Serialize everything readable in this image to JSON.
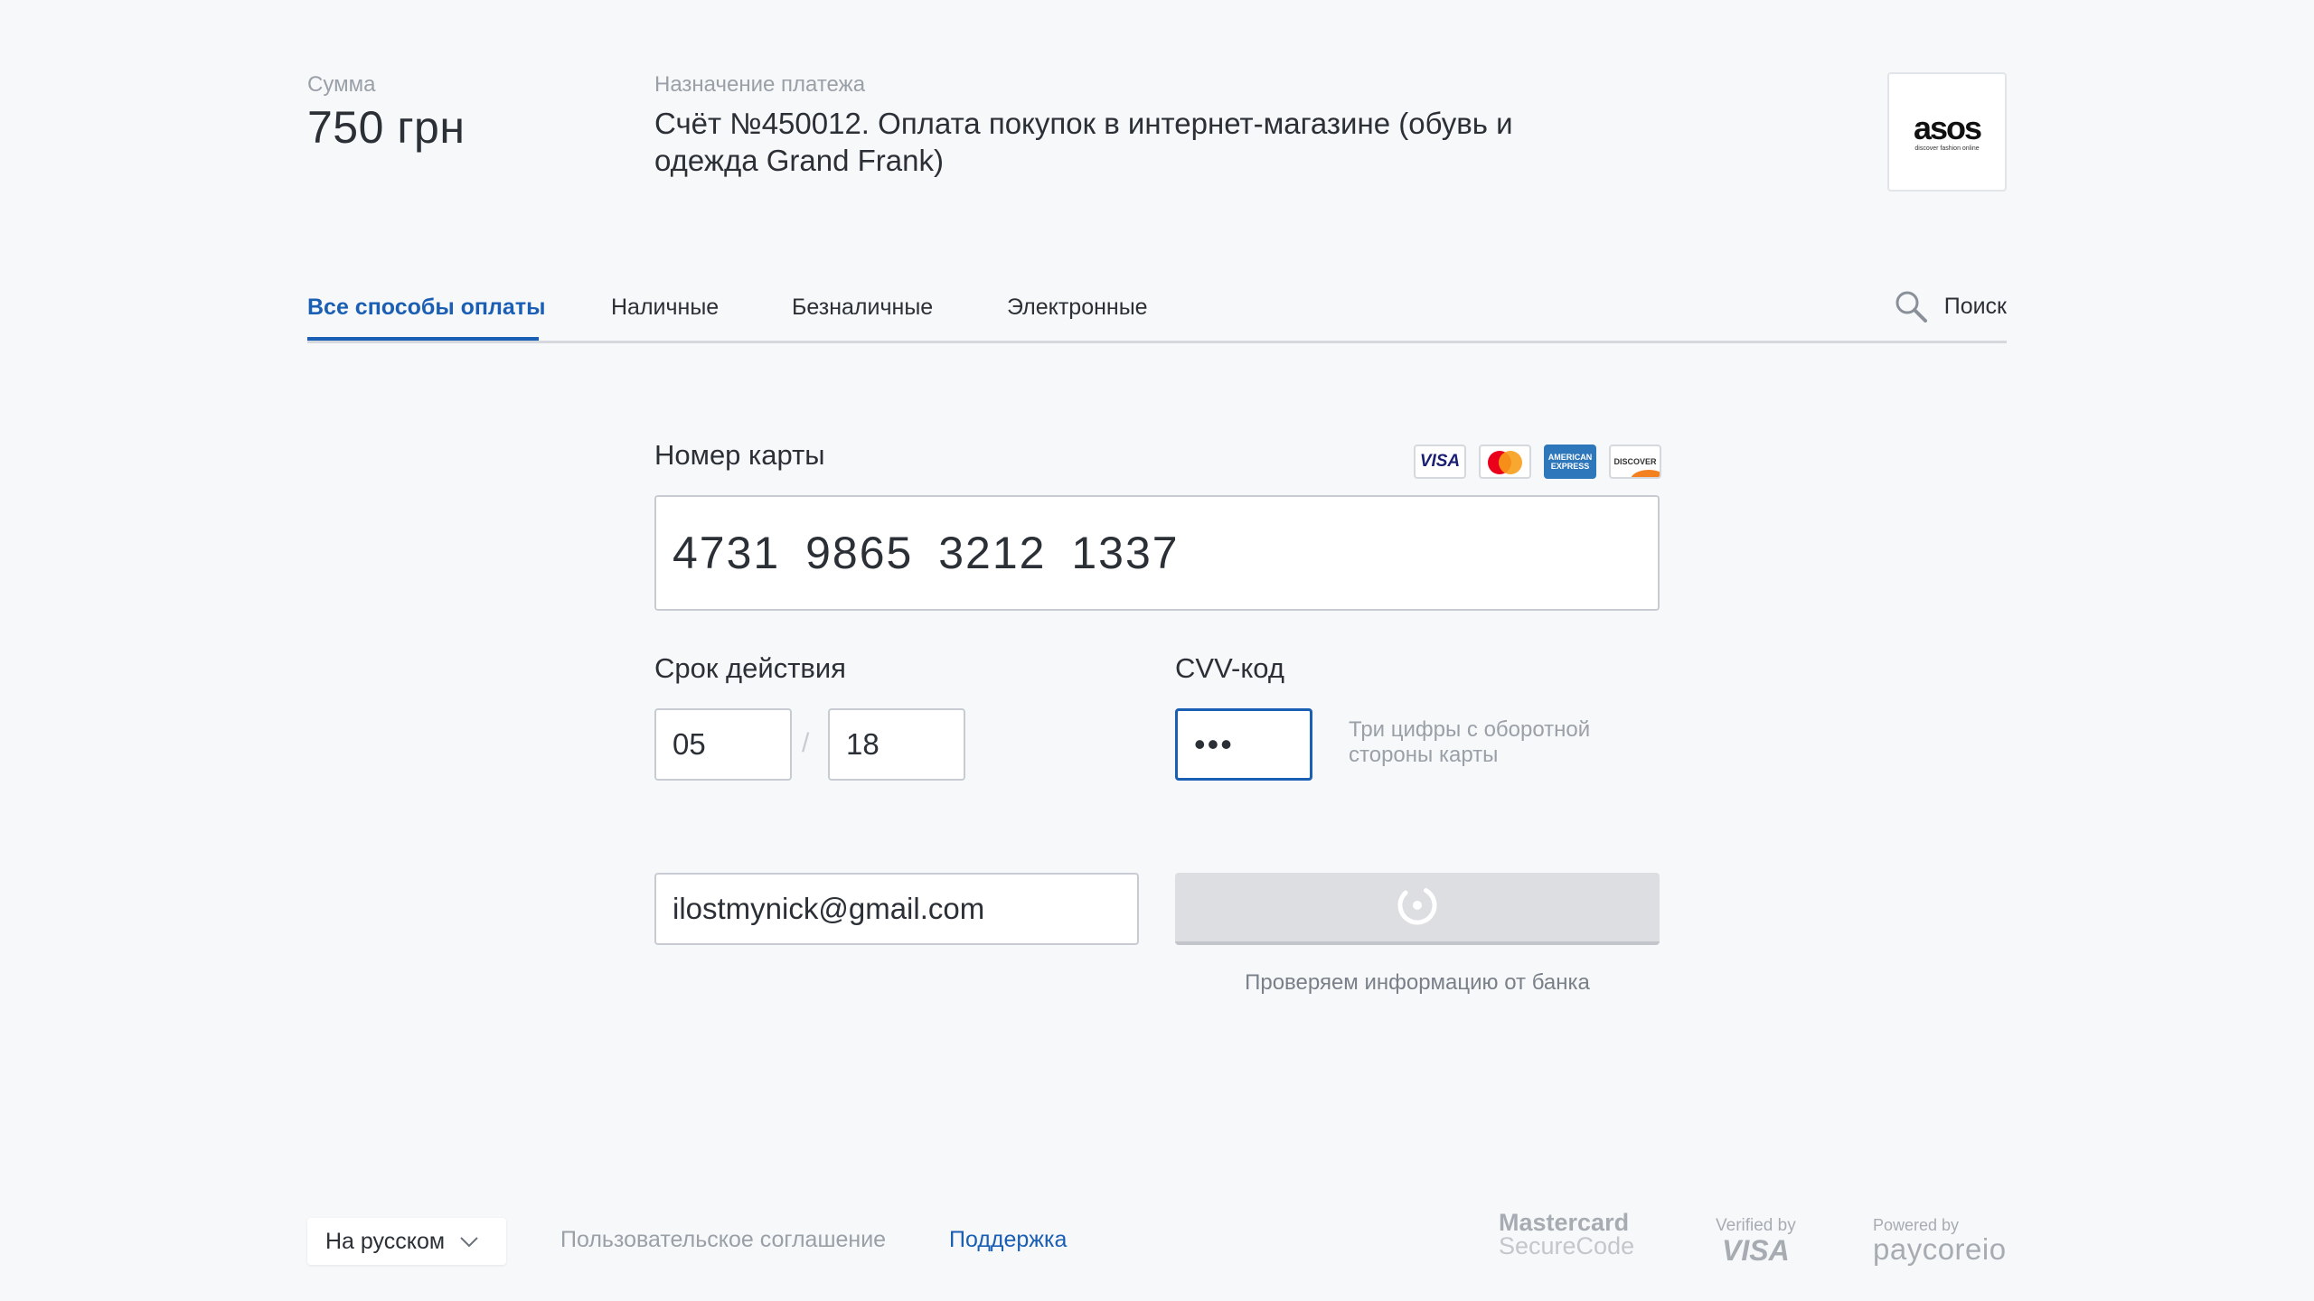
{
  "header": {
    "sum_label": "Сумма",
    "sum_value": "750 грн",
    "purpose_label": "Назначение платежа",
    "purpose_text": "Счёт №450012. Оплата покупок в интернет-магазине (обувь и одежда Grand Frank)",
    "merchant_logo": {
      "word": "asos",
      "tagline": "discover fashion online"
    }
  },
  "tabs": [
    {
      "label": "Все способы оплаты",
      "active": true
    },
    {
      "label": "Наличные",
      "active": false
    },
    {
      "label": "Безналичные",
      "active": false
    },
    {
      "label": "Электронные",
      "active": false
    }
  ],
  "search": {
    "label": "Поиск",
    "icon": "search-icon"
  },
  "form": {
    "card_number_label": "Номер карты",
    "card_number_value": "4731 9865 3212 1337",
    "card_brands": [
      "VISA",
      "MasterCard",
      "AMERICAN EXPRESS",
      "DISCOVER"
    ],
    "expiry_label": "Срок действия",
    "expiry_month": "05",
    "expiry_separator": "/",
    "expiry_year": "18",
    "cvv_label": "CVV-код",
    "cvv_value": "•••",
    "cvv_hint": "Три цифры с оборотной стороны карты",
    "email_value": "ilostmynick@gmail.com",
    "status_text": "Проверяем информацию от банка"
  },
  "footer": {
    "language": "На русском",
    "agreement": "Пользовательское соглашение",
    "support": "Поддержка",
    "badges": {
      "mastercard_line1": "Mastercard",
      "mastercard_line2": "SecureCode",
      "visa_line1": "Verified by",
      "visa_line2": "VISA",
      "paycore_line1": "Powered by",
      "paycore_line2": "paycoreio"
    }
  },
  "colors": {
    "accent": "#1a5fb4",
    "background": "#f7f8fa",
    "muted_text": "#9aa0a8",
    "button_disabled": "#dcdee2"
  }
}
